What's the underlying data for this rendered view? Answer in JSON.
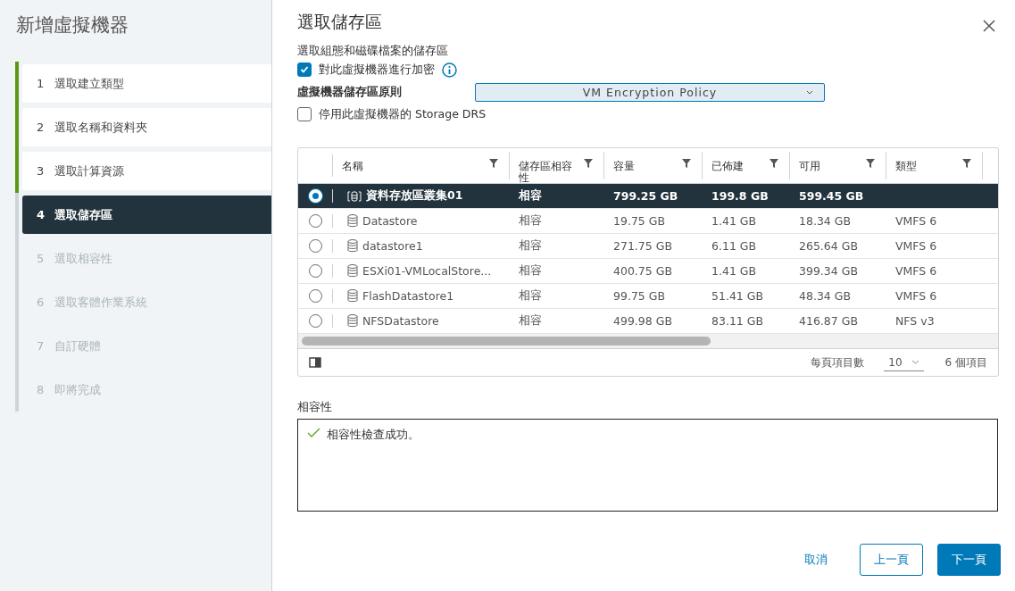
{
  "wizard": {
    "title": "新增虛擬機器",
    "steps": [
      {
        "number": "1",
        "label": "選取建立類型",
        "completed": true,
        "selected": false
      },
      {
        "number": "2",
        "label": "選取名稱和資料夾",
        "completed": true,
        "selected": false
      },
      {
        "number": "3",
        "label": "選取計算資源",
        "completed": true,
        "selected": false
      },
      {
        "number": "4",
        "label": "選取儲存區",
        "completed": false,
        "selected": true
      },
      {
        "number": "5",
        "label": "選取相容性",
        "completed": false,
        "selected": false
      },
      {
        "number": "6",
        "label": "選取客體作業系統",
        "completed": false,
        "selected": false
      },
      {
        "number": "7",
        "label": "自訂硬體",
        "completed": false,
        "selected": false
      },
      {
        "number": "8",
        "label": "即將完成",
        "completed": false,
        "selected": false
      }
    ]
  },
  "page": {
    "title": "選取儲存區",
    "subtitle": "選取組態和磁碟檔案的儲存區",
    "encrypt": {
      "label": "對此虛擬機器進行加密",
      "checked": true
    },
    "policy": {
      "label": "虛擬機器儲存區原則",
      "value": "VM Encryption Policy"
    },
    "disable_drs": {
      "label": "停用此虛擬機器的 Storage DRS",
      "checked": false
    }
  },
  "table": {
    "columns": [
      "名稱",
      "儲存區相容性",
      "容量",
      "已佈建",
      "可用",
      "類型"
    ],
    "rows": [
      {
        "kind": "cluster",
        "selected": true,
        "cells": [
          "資料存放區叢集01",
          "相容",
          "799.25 GB",
          "199.8 GB",
          "599.45 GB",
          ""
        ]
      },
      {
        "kind": "datastore",
        "selected": false,
        "cells": [
          "Datastore",
          "相容",
          "19.75 GB",
          "1.41 GB",
          "18.34 GB",
          "VMFS 6"
        ]
      },
      {
        "kind": "datastore",
        "selected": false,
        "cells": [
          "datastore1",
          "相容",
          "271.75 GB",
          "6.11 GB",
          "265.64 GB",
          "VMFS 6"
        ]
      },
      {
        "kind": "datastore",
        "selected": false,
        "cells": [
          "ESXi01-VMLocalStore...",
          "相容",
          "400.75 GB",
          "1.41 GB",
          "399.34 GB",
          "VMFS 6"
        ]
      },
      {
        "kind": "datastore",
        "selected": false,
        "cells": [
          "FlashDatastore1",
          "相容",
          "99.75 GB",
          "51.41 GB",
          "48.34 GB",
          "VMFS 6"
        ]
      },
      {
        "kind": "datastore",
        "selected": false,
        "cells": [
          "NFSDatastore",
          "相容",
          "499.98 GB",
          "83.11 GB",
          "416.87 GB",
          "NFS v3"
        ]
      }
    ],
    "footer": {
      "page_size_label": "每頁項目數",
      "page_size": "10",
      "count": "6 個項目"
    }
  },
  "compatibility": {
    "label": "相容性",
    "message": "相容性檢查成功。"
  },
  "buttons": {
    "cancel": "取消",
    "back": "上一頁",
    "next": "下一頁"
  }
}
